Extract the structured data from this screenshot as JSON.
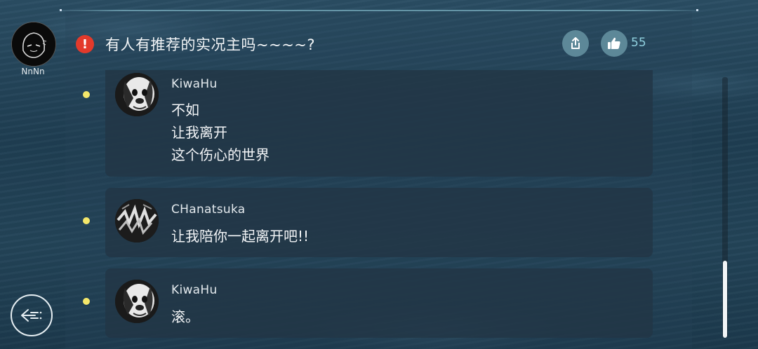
{
  "user": {
    "name": "NnNn"
  },
  "post": {
    "title": "有人有推荐的实况主吗~~~~?",
    "like_count": "55"
  },
  "comments": [
    {
      "author": "KiwaHu",
      "lines": [
        "不如",
        "让我离开",
        "这个伤心的世界"
      ]
    },
    {
      "author": "CHanatsuka",
      "lines": [
        "让我陪你一起离开吧!!"
      ]
    },
    {
      "author": "KiwaHu",
      "lines": [
        "滚。"
      ]
    }
  ],
  "icons": {
    "alert": "alert-icon",
    "share": "share-icon",
    "like": "thumbs-up-icon",
    "back": "back-arrow-icon"
  },
  "colors": {
    "alert": "#e33a2b",
    "bullet": "#f4e76a",
    "accent": "#8fd0de",
    "button_bg": "#5d8898"
  }
}
